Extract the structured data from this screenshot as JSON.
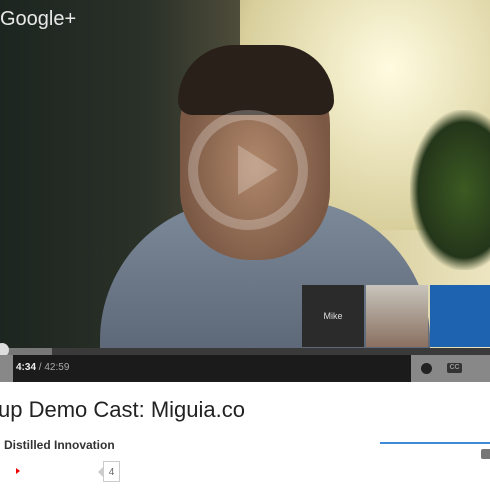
{
  "video": {
    "watermark": "Google+",
    "participants": [
      {
        "name": "Mike",
        "type": "avatar"
      },
      {
        "name": "",
        "type": "webcam"
      },
      {
        "name": "",
        "type": "screenshare"
      }
    ],
    "progress_fraction": 0.106
  },
  "controls": {
    "current_time": "4:34",
    "separator": " / ",
    "duration": "42:59",
    "icons": [
      "clock-icon",
      "cc-icon"
    ]
  },
  "info": {
    "title": "up Demo Cast: Miguia.co",
    "channel": "Distilled Innovation",
    "subscriber_count": "4"
  },
  "colors": {
    "rating_bar": "#3d8bd8",
    "subscribe_icon": "#ee0000"
  }
}
